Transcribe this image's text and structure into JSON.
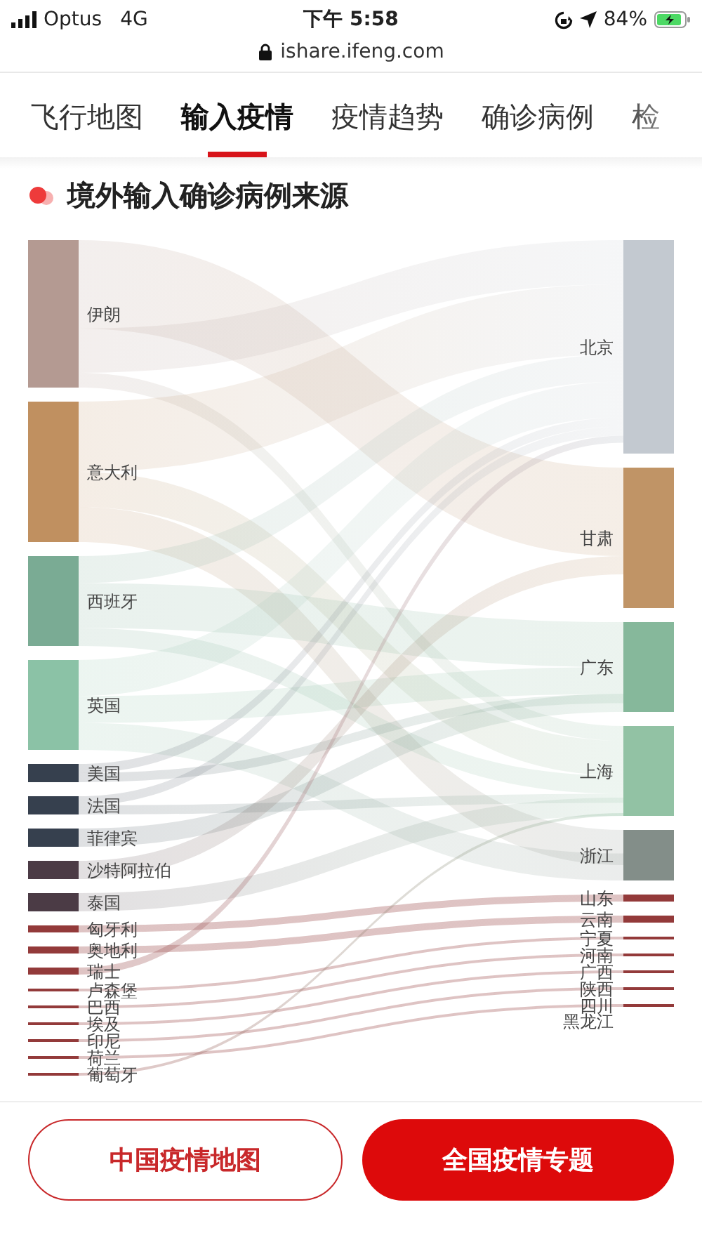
{
  "status_bar": {
    "carrier": "Optus",
    "network": "4G",
    "time": "下午 5:58",
    "battery": "84%"
  },
  "address_bar": {
    "url": "ishare.ifeng.com"
  },
  "tabs": [
    {
      "label": "飞行地图",
      "selected": false
    },
    {
      "label": "输入疫情",
      "selected": true
    },
    {
      "label": "疫情趋势",
      "selected": false
    },
    {
      "label": "确诊病例",
      "selected": false
    },
    {
      "label": "检",
      "selected": false
    }
  ],
  "section": {
    "title": "境外输入确诊病例来源"
  },
  "sankey": {
    "sources": [
      {
        "name": "伊朗",
        "kind": "xl",
        "color": "#b49a92"
      },
      {
        "name": "意大利",
        "kind": "l",
        "color": "#c09060"
      },
      {
        "name": "西班牙",
        "kind": "m",
        "color": "#7aab94"
      },
      {
        "name": "英国",
        "kind": "m",
        "color": "#8bc2a6"
      },
      {
        "name": "美国",
        "kind": "s",
        "color": "#36404e"
      },
      {
        "name": "法国",
        "kind": "s",
        "color": "#36404e"
      },
      {
        "name": "菲律宾",
        "kind": "s",
        "color": "#36404e"
      },
      {
        "name": "沙特阿拉伯",
        "kind": "s",
        "color": "#4b3b45"
      },
      {
        "name": "泰国",
        "kind": "s",
        "color": "#4b3b45"
      },
      {
        "name": "匈牙利",
        "kind": "xs",
        "color": "#933a3a"
      },
      {
        "name": "奥地利",
        "kind": "xs",
        "color": "#933a3a"
      },
      {
        "name": "瑞士",
        "kind": "xs",
        "color": "#933a3a"
      },
      {
        "name": "卢森堡",
        "kind": "line",
        "color": "#933a3a"
      },
      {
        "name": "巴西",
        "kind": "line",
        "color": "#933a3a"
      },
      {
        "name": "埃及",
        "kind": "line",
        "color": "#933a3a"
      },
      {
        "name": "印尼",
        "kind": "line",
        "color": "#933a3a"
      },
      {
        "name": "荷兰",
        "kind": "line",
        "color": "#933a3a"
      },
      {
        "name": "葡萄牙",
        "kind": "line",
        "color": "#933a3a"
      }
    ],
    "targets": [
      {
        "name": "北京",
        "kind": "xxl",
        "color": "#c3c9d0"
      },
      {
        "name": "甘肃",
        "kind": "l",
        "color": "#c09466"
      },
      {
        "name": "广东",
        "kind": "m",
        "color": "#86b89b"
      },
      {
        "name": "上海",
        "kind": "m",
        "color": "#92c2a4"
      },
      {
        "name": "浙江",
        "kind": "ms",
        "color": "#838e89"
      },
      {
        "name": "山东",
        "kind": "xs",
        "color": "#933a3a"
      },
      {
        "name": "云南",
        "kind": "xs",
        "color": "#933a3a"
      },
      {
        "name": "宁夏",
        "kind": "line",
        "color": "#933a3a"
      },
      {
        "name": "河南",
        "kind": "line",
        "color": "#933a3a"
      },
      {
        "name": "广西",
        "kind": "line",
        "color": "#933a3a"
      },
      {
        "name": "陕西",
        "kind": "line",
        "color": "#933a3a"
      },
      {
        "name": "四川",
        "kind": "line",
        "color": "#933a3a"
      },
      {
        "name": "黑龙江",
        "kind": "none"
      }
    ]
  },
  "buttons": [
    {
      "label": "中国疫情地图",
      "kind": "outline"
    },
    {
      "label": "全国疫情专题",
      "kind": "filled"
    }
  ]
}
